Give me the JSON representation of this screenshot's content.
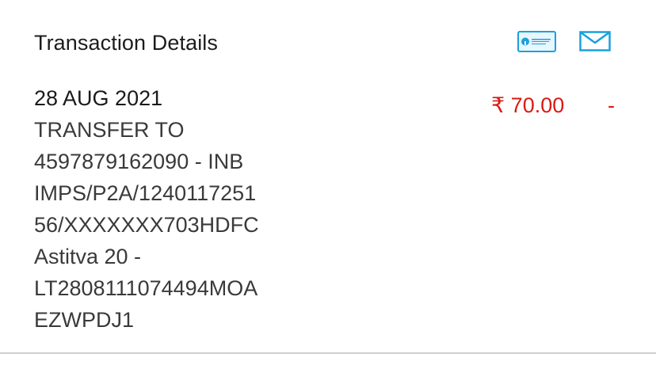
{
  "header": {
    "title": "Transaction Details",
    "passbook_icon": "passbook-icon",
    "mail_icon": "mail-icon"
  },
  "transaction": {
    "date": "28 AUG 2021",
    "description_lines": [
      "TRANSFER TO",
      "4597879162090 - INB",
      "IMPS/P2A/1240117251",
      "56/XXXXXXX703HDFC",
      "Astitva 20 -",
      "LT2808111074494MOA",
      "EZWPDJ1"
    ],
    "amount": "₹ 70.00",
    "type_indicator": "-"
  },
  "colors": {
    "accent": "#1aa0dd",
    "amount_debit": "#d81b14",
    "divider": "#cfcfcf"
  }
}
